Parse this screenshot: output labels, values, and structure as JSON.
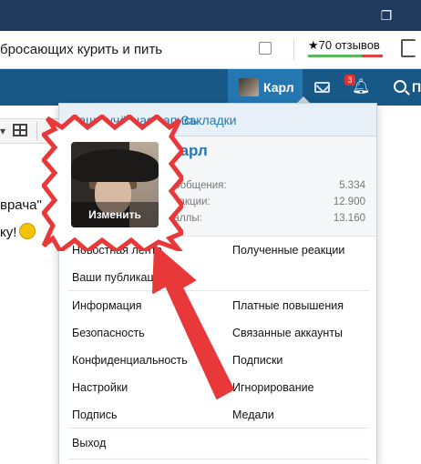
{
  "browser": {
    "page_title_fragment": "бросающих курить и пить",
    "reviews_label": "★70 отзывов"
  },
  "nav": {
    "user_name": "Карл",
    "alerts_badge": "3",
    "search_label": "П"
  },
  "post": {
    "line1": "врача\"",
    "line2": "ку!"
  },
  "menu": {
    "tab_account": "Ваша учётная запись",
    "tab_bookmarks": "Закладки",
    "profile_name": "Карл",
    "avatar_change": "Изменить",
    "stats": [
      {
        "label": "Сообщения:",
        "value": "5.334"
      },
      {
        "label": "Реакции:",
        "value": "12.900"
      },
      {
        "label": "Баллы:",
        "value": "13.160"
      }
    ],
    "section1_left": [
      "Новостная лента",
      "Ваши публикации"
    ],
    "section1_right": [
      "Полученные реакции"
    ],
    "section2_left": [
      "Информация",
      "Безопасность",
      "Конфиденциальность",
      "Настройки",
      "Подпись"
    ],
    "section2_right": [
      "Платные повышения",
      "Связанные аккаунты",
      "Подписки",
      "Игнорирование",
      "Медали"
    ],
    "logout": "Выход"
  },
  "colors": {
    "nav_bg": "#185886",
    "accent": "#2577b1",
    "annotation_red": "#e8383a"
  }
}
